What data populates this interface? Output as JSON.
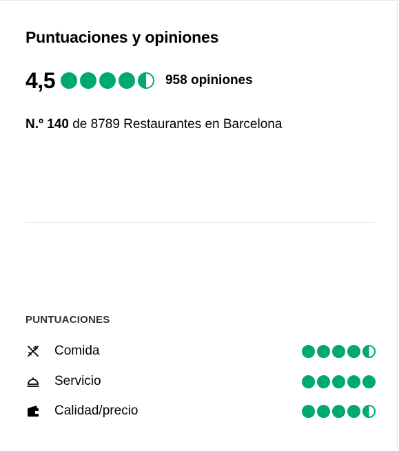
{
  "header": {
    "title": "Puntuaciones y opiniones"
  },
  "overall": {
    "rating_text": "4,5",
    "rating_value": 4.5,
    "reviews_text": "958 opiniones"
  },
  "rank": {
    "position": "N.º 140",
    "rest": " de 8789 Restaurantes en Barcelona"
  },
  "scores": {
    "section_label": "PUNTUACIONES",
    "items": [
      {
        "label": "Comida",
        "icon": "utensils-crossed-icon",
        "rating": 4.5
      },
      {
        "label": "Servicio",
        "icon": "service-bell-icon",
        "rating": 5
      },
      {
        "label": "Calidad/precio",
        "icon": "wallet-icon",
        "rating": 4.5
      }
    ]
  },
  "colors": {
    "bubble_green": "#00aa6c"
  }
}
